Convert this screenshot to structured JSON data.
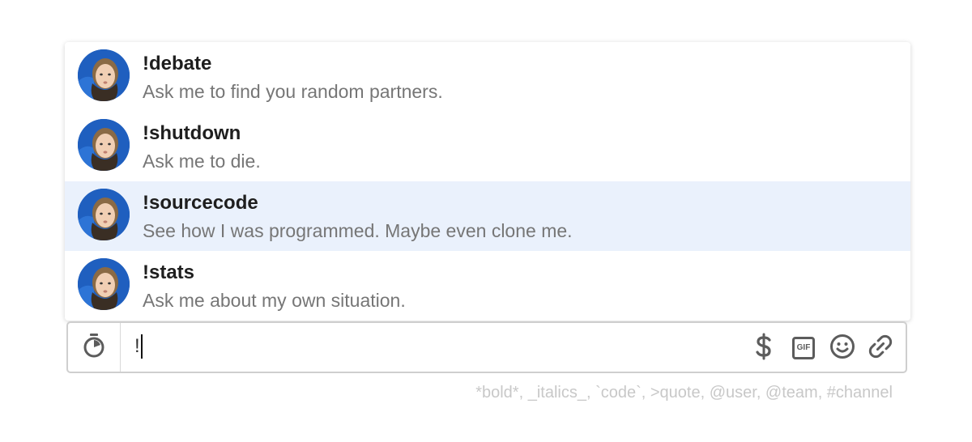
{
  "commands": [
    {
      "name": "!debate",
      "description": "Ask me to find you random partners.",
      "selected": false
    },
    {
      "name": "!shutdown",
      "description": "Ask me to die.",
      "selected": false
    },
    {
      "name": "!sourcecode",
      "description": "See how I was programmed. Maybe even clone me.",
      "selected": true
    },
    {
      "name": "!stats",
      "description": "Ask me about my own situation.",
      "selected": false
    }
  ],
  "composer": {
    "value": "!",
    "left_icon": "stopwatch-icon",
    "tools": [
      "dollar-icon",
      "gif-icon",
      "emoji-icon",
      "attachment-icon"
    ],
    "gif_label": "GIF"
  },
  "format_hint": "*bold*, _italics_, `code`, >quote, @user, @team, #channel",
  "colors": {
    "selected_row": "#eaf1fc",
    "command_text": "#1e1e1e",
    "description_text": "#767676",
    "icon": "#5c5c5c",
    "hint": "#c8c8c8"
  }
}
